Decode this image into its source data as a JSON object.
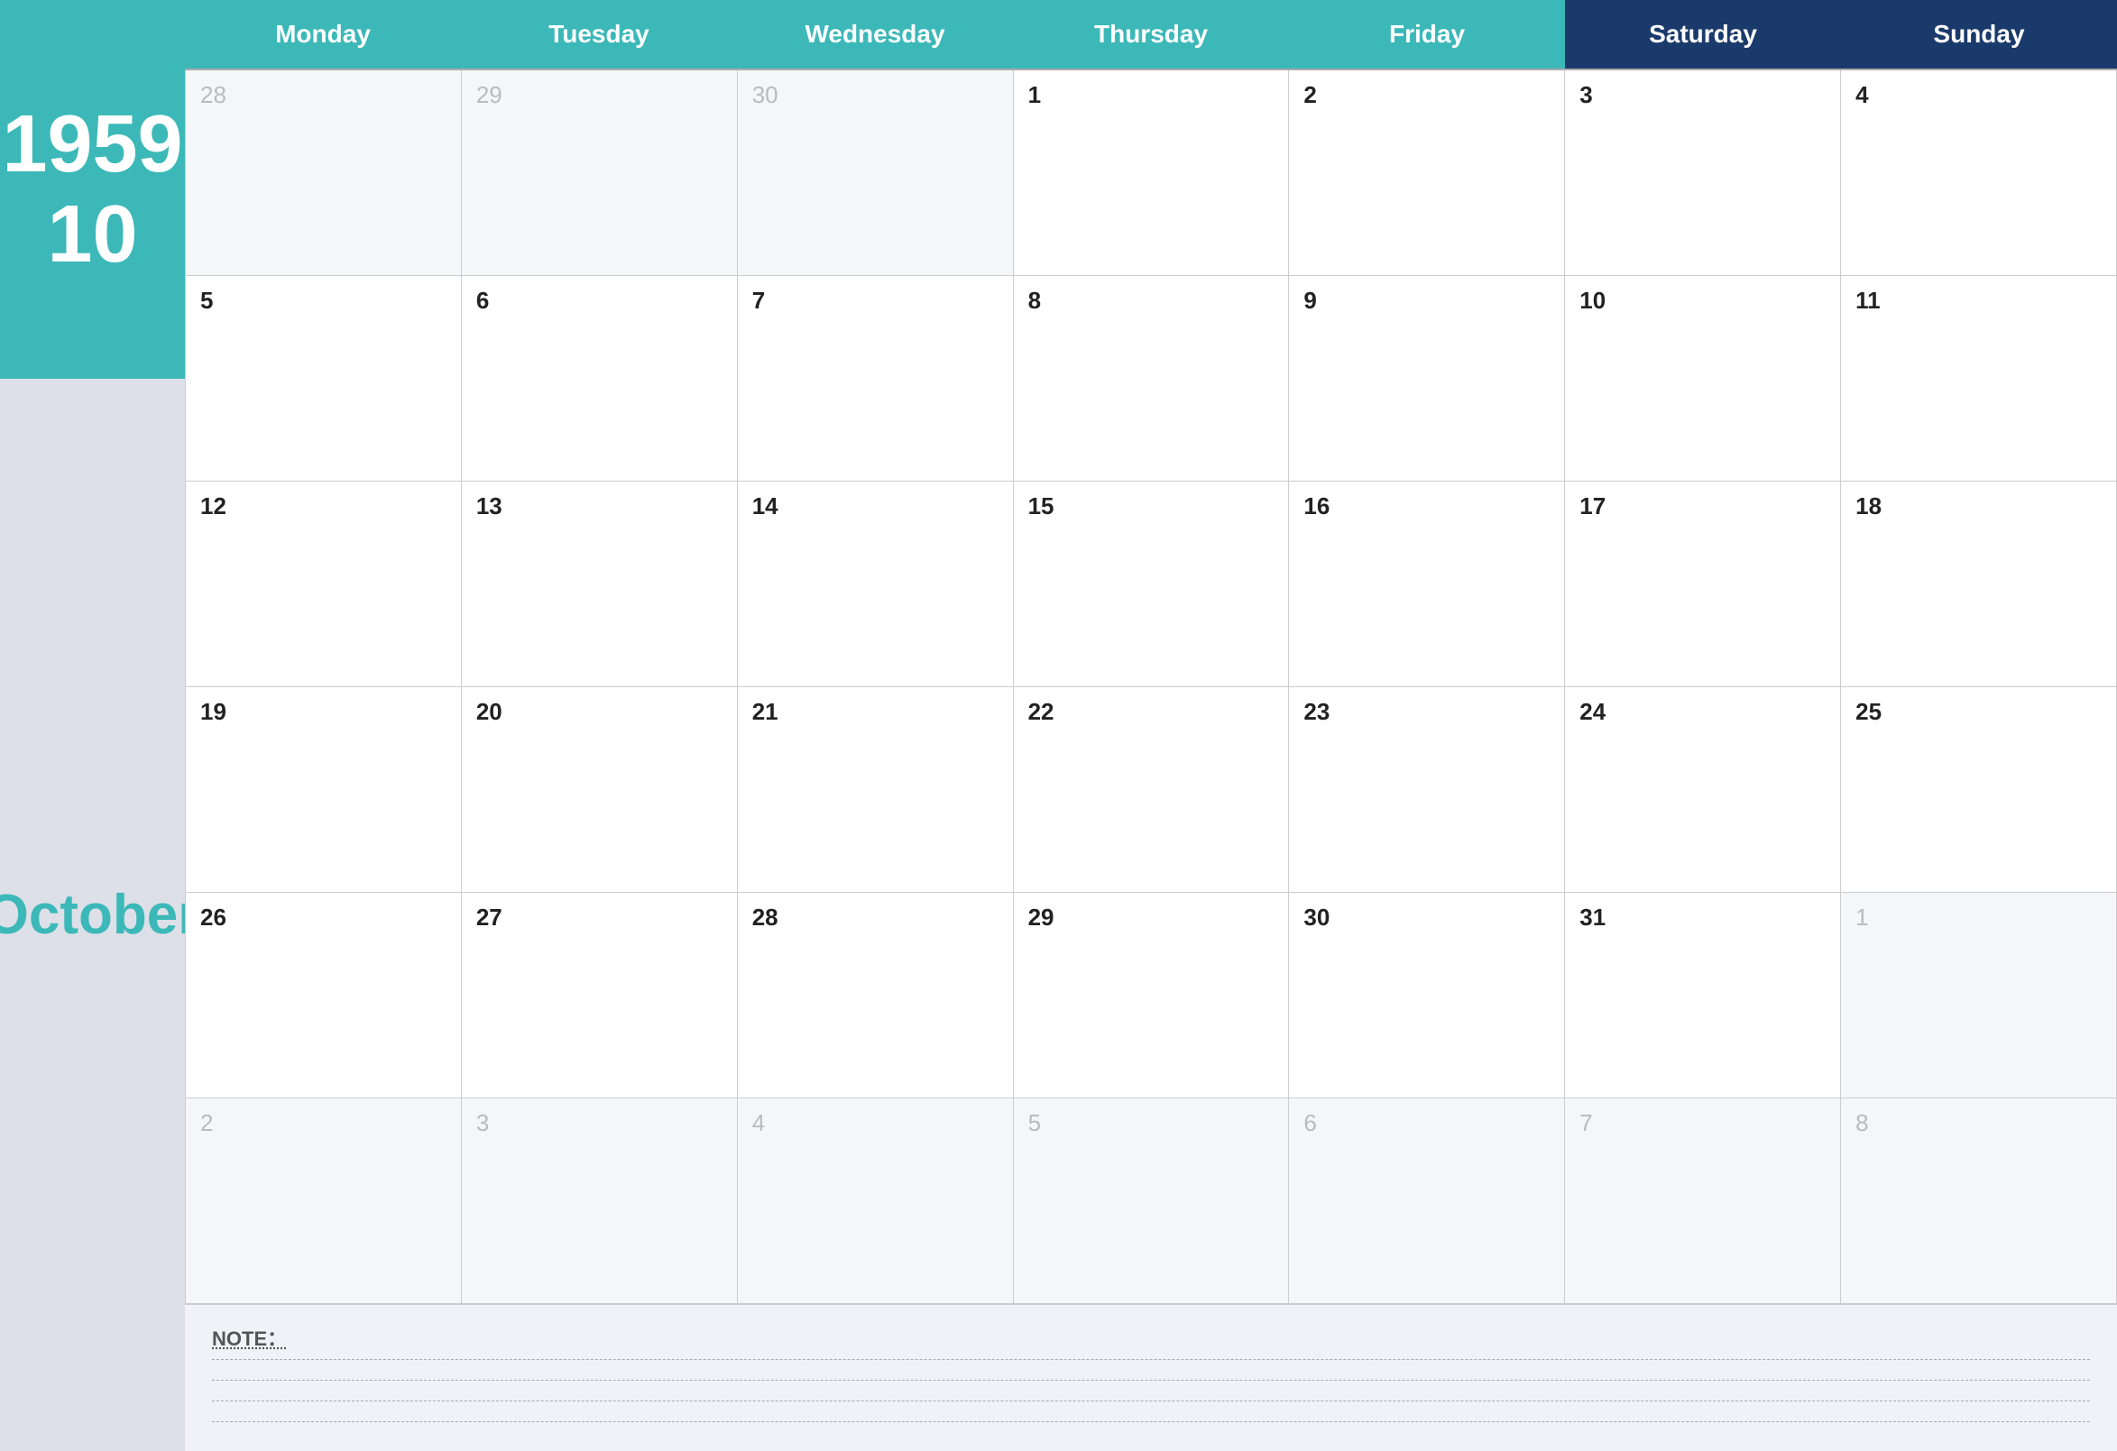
{
  "sidebar": {
    "year": "1959",
    "month_num": "10",
    "month_name": "October"
  },
  "header": {
    "days": [
      {
        "label": "Monday",
        "style": "teal"
      },
      {
        "label": "Tuesday",
        "style": "teal"
      },
      {
        "label": "Wednesday",
        "style": "teal"
      },
      {
        "label": "Thursday",
        "style": "teal"
      },
      {
        "label": "Friday",
        "style": "teal"
      },
      {
        "label": "Saturday",
        "style": "dark-blue"
      },
      {
        "label": "Sunday",
        "style": "dark-blue"
      }
    ]
  },
  "notes": {
    "label": "NOTE："
  },
  "weeks": [
    [
      {
        "num": "28",
        "other": true
      },
      {
        "num": "29",
        "other": true
      },
      {
        "num": "30",
        "other": true
      },
      {
        "num": "1",
        "other": false
      },
      {
        "num": "2",
        "other": false
      },
      {
        "num": "3",
        "other": false
      },
      {
        "num": "4",
        "other": false
      }
    ],
    [
      {
        "num": "5",
        "other": false
      },
      {
        "num": "6",
        "other": false
      },
      {
        "num": "7",
        "other": false
      },
      {
        "num": "8",
        "other": false
      },
      {
        "num": "9",
        "other": false
      },
      {
        "num": "10",
        "other": false
      },
      {
        "num": "11",
        "other": false
      }
    ],
    [
      {
        "num": "12",
        "other": false
      },
      {
        "num": "13",
        "other": false
      },
      {
        "num": "14",
        "other": false
      },
      {
        "num": "15",
        "other": false
      },
      {
        "num": "16",
        "other": false
      },
      {
        "num": "17",
        "other": false
      },
      {
        "num": "18",
        "other": false
      }
    ],
    [
      {
        "num": "19",
        "other": false
      },
      {
        "num": "20",
        "other": false
      },
      {
        "num": "21",
        "other": false
      },
      {
        "num": "22",
        "other": false
      },
      {
        "num": "23",
        "other": false
      },
      {
        "num": "24",
        "other": false
      },
      {
        "num": "25",
        "other": false
      }
    ],
    [
      {
        "num": "26",
        "other": false
      },
      {
        "num": "27",
        "other": false
      },
      {
        "num": "28",
        "other": false
      },
      {
        "num": "29",
        "other": false
      },
      {
        "num": "30",
        "other": false
      },
      {
        "num": "31",
        "other": false
      },
      {
        "num": "1",
        "other": true
      }
    ],
    [
      {
        "num": "2",
        "other": true
      },
      {
        "num": "3",
        "other": true
      },
      {
        "num": "4",
        "other": true
      },
      {
        "num": "5",
        "other": true
      },
      {
        "num": "6",
        "other": true
      },
      {
        "num": "7",
        "other": true
      },
      {
        "num": "8",
        "other": true
      }
    ]
  ]
}
